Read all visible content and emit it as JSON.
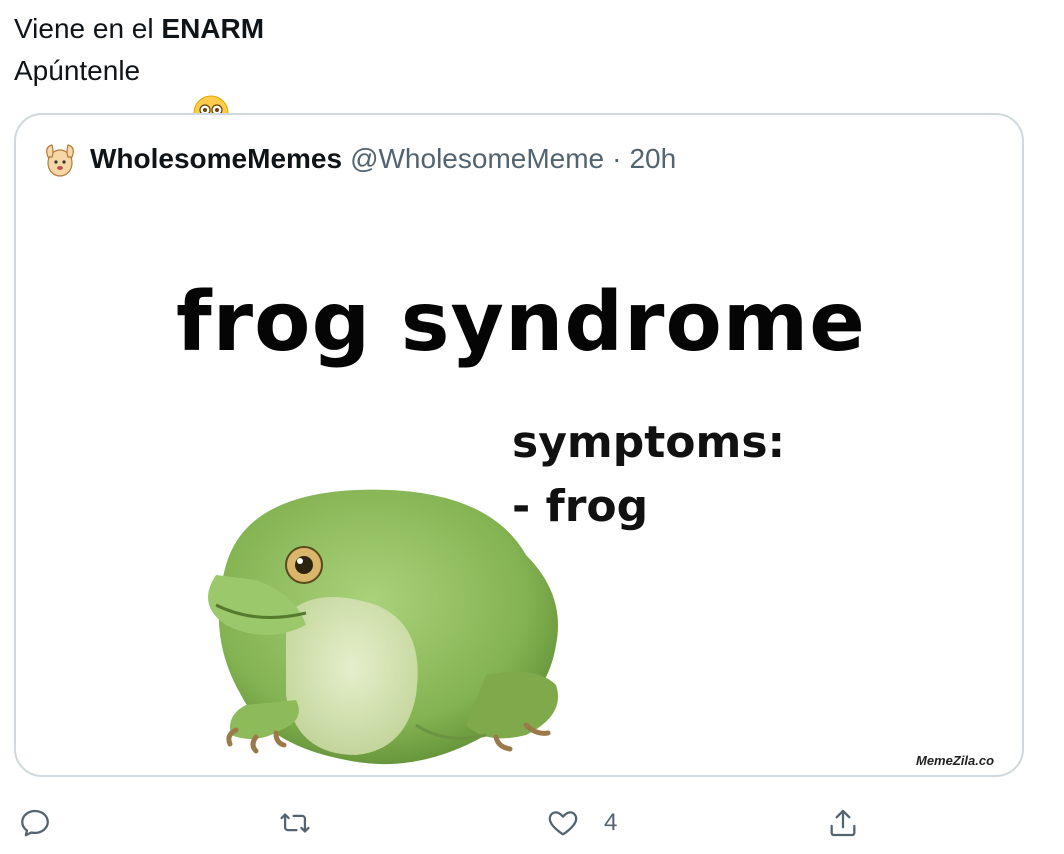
{
  "tweet": {
    "line1_prefix": "Viene en el ",
    "line1_bold": "ENARM",
    "line2_text": "Apúntenle",
    "emoji": "flushed-face-emoji"
  },
  "quote": {
    "author_name": "WholesomeMemes",
    "author_handle": "@WholesomeMeme",
    "separator": "·",
    "time": "20h",
    "avatar": "cartoon-avatar"
  },
  "meme": {
    "title": "frog syndrome",
    "symptoms_label": "symptoms:",
    "symptom_item": "- frog",
    "watermark": "MemeZila.co"
  },
  "actions": {
    "reply": {
      "icon": "reply-icon"
    },
    "retweet": {
      "icon": "retweet-icon"
    },
    "like": {
      "icon": "heart-icon",
      "count": "4"
    },
    "share": {
      "icon": "share-icon"
    }
  },
  "colors": {
    "text": "#0f1419",
    "muted": "#536471",
    "border": "#cfd9de",
    "frog_green": "#8dbb5a"
  }
}
